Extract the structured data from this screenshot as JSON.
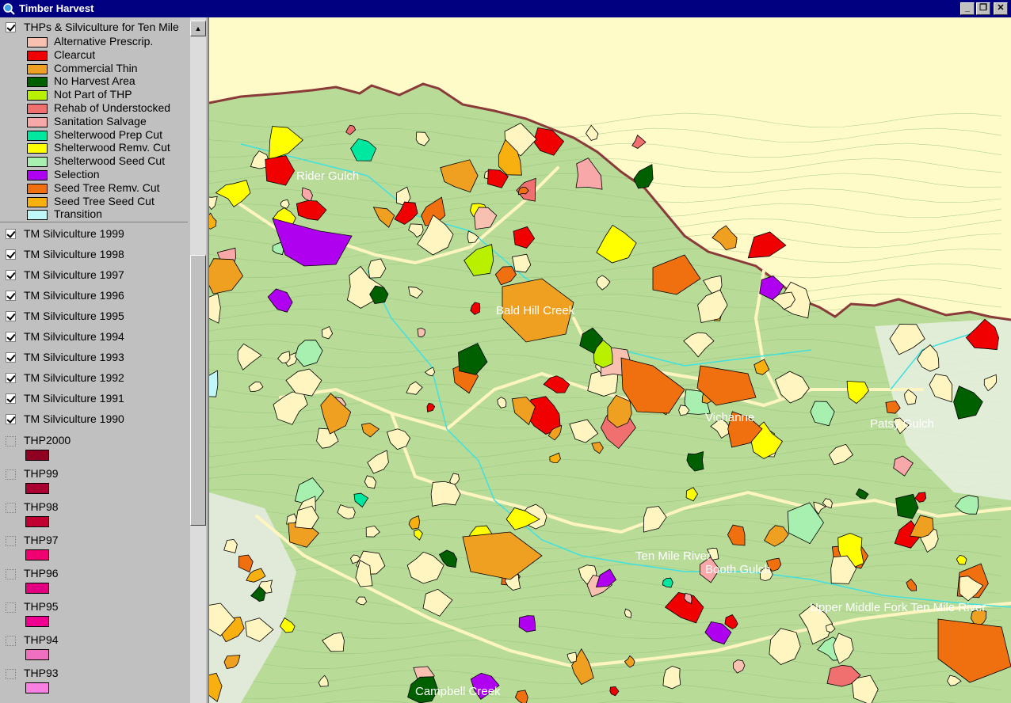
{
  "window": {
    "title": "Timber Harvest",
    "buttons": {
      "minimize": "_",
      "restore": "❐",
      "close": "✕"
    }
  },
  "legend": {
    "main_layer": {
      "name": "THPs & Silviculture for Ten Mile",
      "checked": true,
      "classes": [
        {
          "label": "Alternative Prescrip.",
          "color": "#f8c0b0"
        },
        {
          "label": "Clearcut",
          "color": "#f00000"
        },
        {
          "label": "Commercial Thin",
          "color": "#f0a020"
        },
        {
          "label": "No Harvest Area",
          "color": "#006000"
        },
        {
          "label": "Not Part of THP",
          "color": "#b8f000"
        },
        {
          "label": "Rehab of Understocked",
          "color": "#f07070"
        },
        {
          "label": "Sanitation Salvage",
          "color": "#f8a8a8"
        },
        {
          "label": "Shelterwood Prep Cut",
          "color": "#00e8a0"
        },
        {
          "label": "Shelterwood Remv. Cut",
          "color": "#ffff00"
        },
        {
          "label": "Shelterwood Seed Cut",
          "color": "#a8f0b0"
        },
        {
          "label": "Selection",
          "color": "#b000f0"
        },
        {
          "label": "Seed Tree Remv. Cut",
          "color": "#f07010"
        },
        {
          "label": "Seed Tree Seed Cut",
          "color": "#f8b010"
        },
        {
          "label": "Transition",
          "color": "#c0f8f8"
        }
      ]
    },
    "silviculture_layers": [
      {
        "name": "TM Silviculture 1999",
        "checked": true
      },
      {
        "name": "TM Silviculture 1998",
        "checked": true
      },
      {
        "name": "TM Silviculture 1997",
        "checked": true
      },
      {
        "name": "TM Silviculture 1996",
        "checked": true
      },
      {
        "name": "TM Silviculture 1995",
        "checked": true
      },
      {
        "name": "TM Silviculture 1994",
        "checked": true
      },
      {
        "name": "TM Silviculture 1993",
        "checked": true
      },
      {
        "name": "TM Silviculture 1992",
        "checked": true
      },
      {
        "name": "TM Silviculture 1991",
        "checked": true
      },
      {
        "name": "TM Silviculture 1990",
        "checked": true
      }
    ],
    "thp_layers": [
      {
        "name": "THP2000",
        "color": "#900020",
        "checked": false
      },
      {
        "name": "THP99",
        "color": "#a80030",
        "checked": false
      },
      {
        "name": "THP98",
        "color": "#c00030",
        "checked": false
      },
      {
        "name": "THP97",
        "color": "#f00070",
        "checked": false
      },
      {
        "name": "THP96",
        "color": "#e00080",
        "checked": false
      },
      {
        "name": "THP95",
        "color": "#f00090",
        "checked": false
      },
      {
        "name": "THP94",
        "color": "#f070c0",
        "checked": false
      },
      {
        "name": "THP93",
        "color": "#f880e0",
        "checked": false
      }
    ]
  },
  "map": {
    "colors": {
      "background": "#fffbc8",
      "forest": "#b8dc98",
      "boundary": "#8b3a3a",
      "road": "#fff5c0",
      "stream": "#40e0e0",
      "contour": "#8fc078"
    },
    "place_labels": [
      "Rider Gulch",
      "Bald Hill Creek",
      "Vichanne",
      "Patsy Gulch",
      "Booth Gulch",
      "Ten Mile River",
      "Upper Middle Fork Ten Mile River",
      "Campbell Creek"
    ]
  }
}
